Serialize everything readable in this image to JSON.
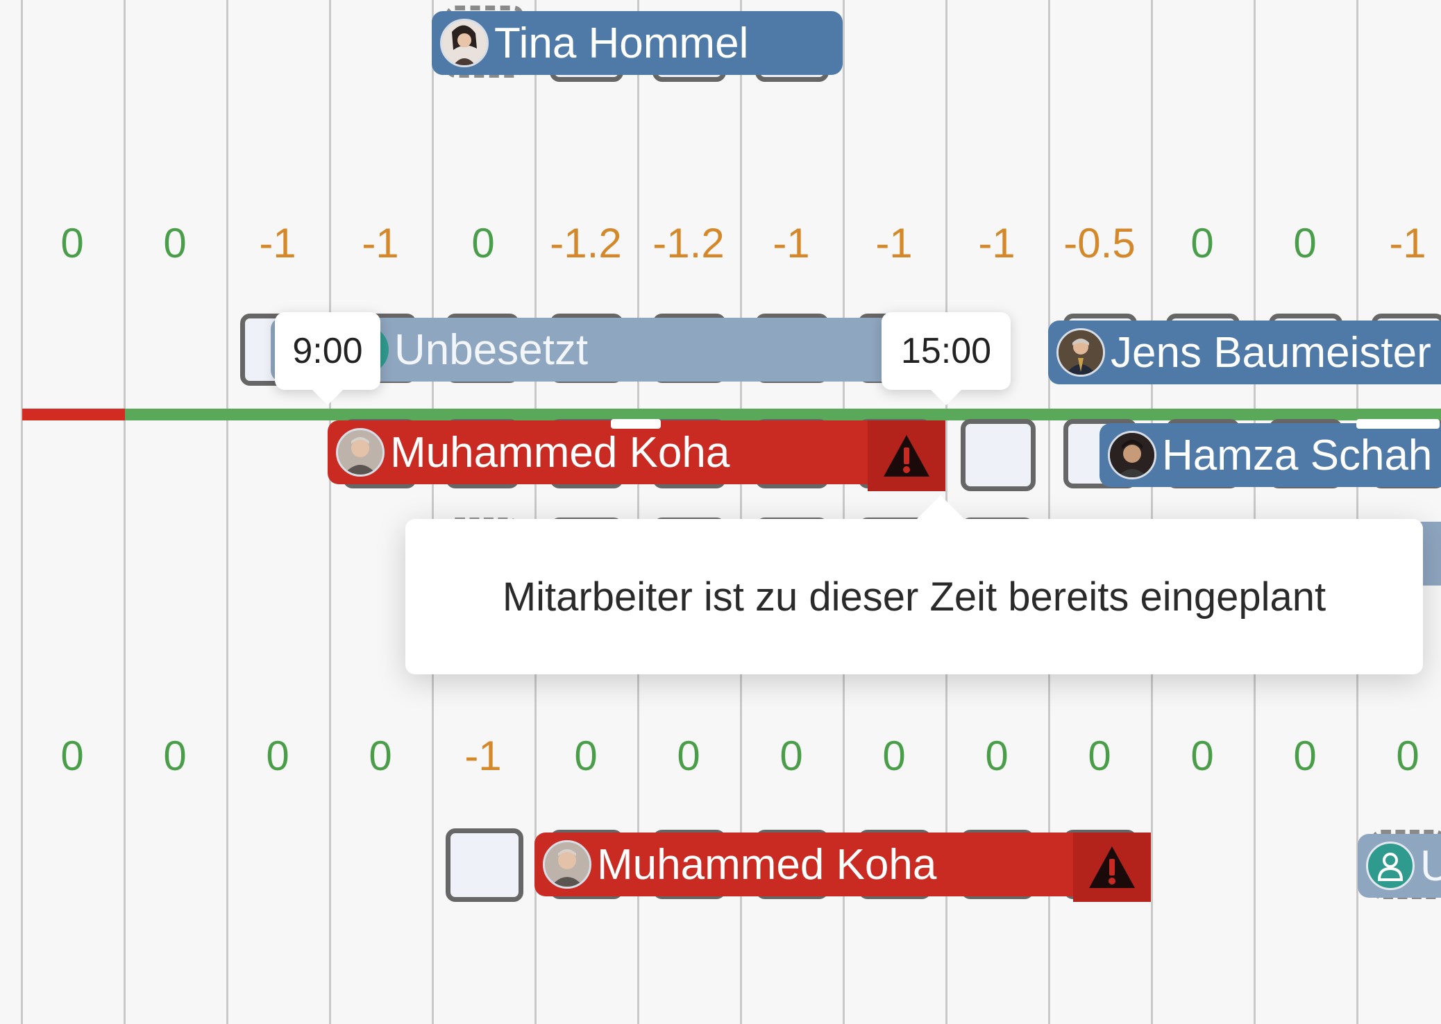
{
  "rows": {
    "top": {
      "shift": {
        "employee": "Tina Hommel",
        "avatar": "woman-avatar-icon",
        "color": "#4f7aa8"
      }
    },
    "coverage_1": {
      "values": [
        "0",
        "0",
        "-1",
        "-1",
        "0",
        "-1.2",
        "-1.2",
        "-1",
        "-1",
        "-1",
        "-0.5",
        "0",
        "0",
        "-1"
      ]
    },
    "shift_row_1": {
      "unassigned": {
        "label": "Unbesetzt",
        "color": "#8fa6c0"
      },
      "start_time": "9:00",
      "end_time": "15:00",
      "right_shift": {
        "employee": "Jens Baumeister",
        "avatar": "man-suit-avatar-icon",
        "color": "#4f7aa8"
      }
    },
    "shift_row_2": {
      "conflict_shift": {
        "employee": "Muhammed Koha",
        "avatar": "man-avatar-icon",
        "color": "#c92a22",
        "warning_icon": "warning-triangle-icon"
      },
      "right_shift": {
        "employee": "Hamza Schah",
        "avatar": "man-avatar-icon",
        "color": "#4f7aa8"
      }
    },
    "conflict_tooltip": {
      "text": "Mitarbeiter ist zu dieser Zeit bereits eingeplant"
    },
    "coverage_2": {
      "values": [
        "0",
        "0",
        "0",
        "0",
        "-1",
        "0",
        "0",
        "0",
        "0",
        "0",
        "0",
        "0",
        "0",
        "0"
      ]
    },
    "shift_row_3": {
      "conflict_shift": {
        "employee": "Muhammed Koha",
        "avatar": "man-avatar-icon",
        "color": "#c92a22",
        "warning_icon": "warning-triangle-icon"
      },
      "right_partial_shift": {
        "label": "U",
        "avatar": "person-icon",
        "color": "#8fa6c0"
      }
    }
  },
  "colors": {
    "ok": "#4a9e4a",
    "warn": "#d4882a",
    "conflict": "#c92a22",
    "assigned": "#4f7aa8",
    "unassigned": "#8fa6c0",
    "timeline_ok": "#5aa85a",
    "timeline_bad": "#d12b22"
  }
}
